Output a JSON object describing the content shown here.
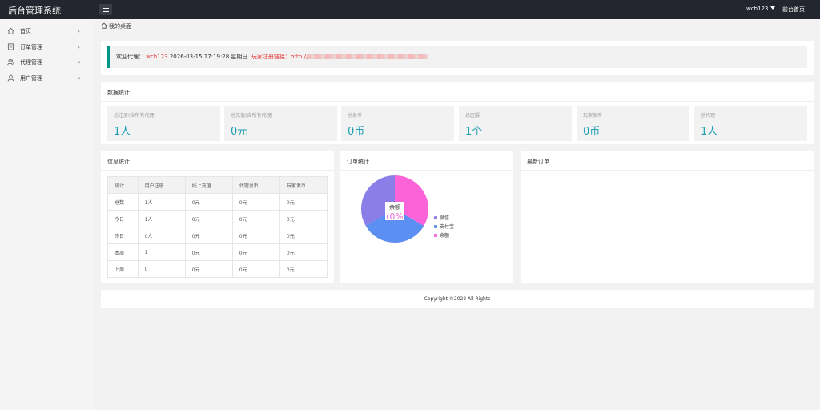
{
  "app": {
    "brand": "后台管理系统",
    "user": "wch123",
    "home_link": "前台首页"
  },
  "sidebar": {
    "items": [
      {
        "label": "首页",
        "icon": "home-icon"
      },
      {
        "label": "订单管理",
        "icon": "document-icon"
      },
      {
        "label": "代理管理",
        "icon": "users-icon"
      },
      {
        "label": "用户管理",
        "icon": "user-icon"
      }
    ]
  },
  "breadcrumb": {
    "label": "我的桌面"
  },
  "welcome": {
    "prefix": "欢迎代理：",
    "username": "wch123",
    "datetime": "2026-03-15  17:19:28  星期日",
    "register_label": "玩家注册链接：http://"
  },
  "stats": {
    "title": "数据统计",
    "items": [
      {
        "label": "总注册(含所有代理)",
        "value": "1人"
      },
      {
        "label": "总充值(含所有代理)",
        "value": "0元"
      },
      {
        "label": "总发币",
        "value": "0币"
      },
      {
        "label": "总区服",
        "value": "1个"
      },
      {
        "label": "玩家发币",
        "value": "0币"
      },
      {
        "label": "总代理",
        "value": "1人"
      }
    ]
  },
  "info": {
    "title": "信息统计",
    "headers": [
      "统计",
      "用户注册",
      "线上充值",
      "代理发币",
      "玩家发币"
    ],
    "rows": [
      [
        "总数",
        "1人",
        "0元",
        "0元",
        "0元"
      ],
      [
        "今日",
        "1人",
        "0元",
        "0元",
        "0元"
      ],
      [
        "昨日",
        "0人",
        "0元",
        "0元",
        "0元"
      ],
      [
        "本周",
        "1",
        "0元",
        "0元",
        "0元"
      ],
      [
        "上周",
        "0",
        "0元",
        "0元",
        "0元"
      ]
    ]
  },
  "orders": {
    "title": "订单统计",
    "center_label": "余额",
    "center_value": "(0%",
    "legend": [
      {
        "name": "微信",
        "color": "#8b7ee8"
      },
      {
        "name": "支付宝",
        "color": "#5b8ff2"
      },
      {
        "name": "余额",
        "color": "#fb63d8"
      }
    ]
  },
  "latest": {
    "title": "最新订单"
  },
  "footer": {
    "copyright": "Copyright ©2022 All Rights"
  }
}
